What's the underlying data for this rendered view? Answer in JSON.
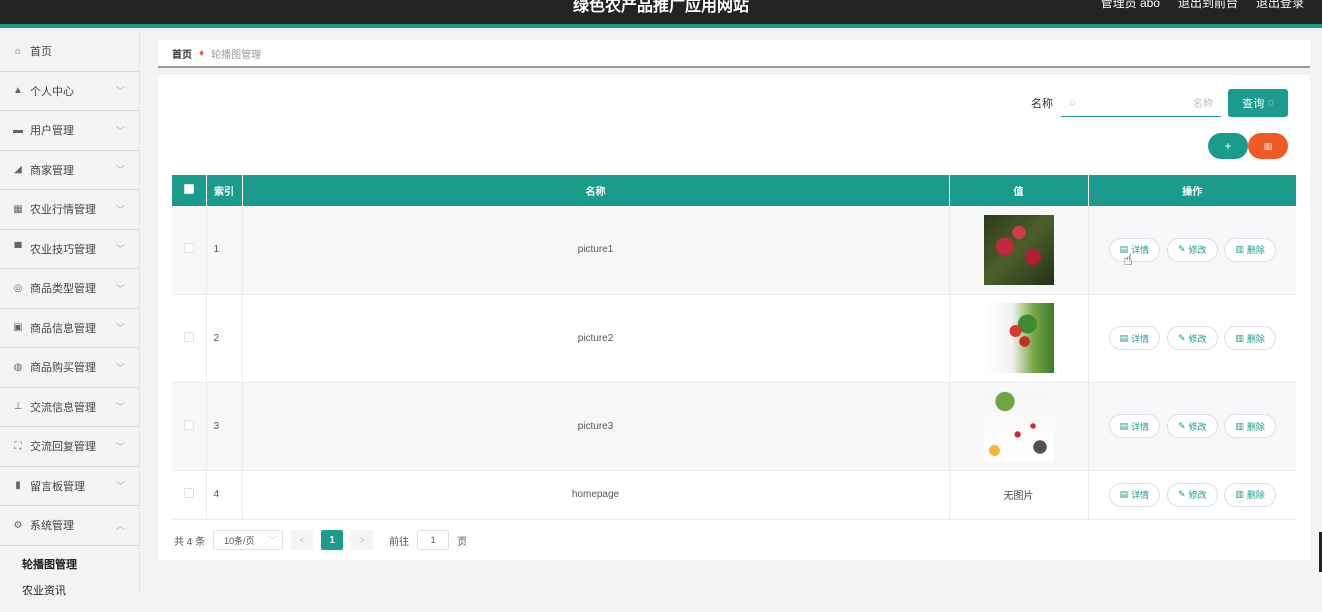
{
  "header": {
    "site_title": "绿色农产品推广应用网站",
    "user_label": "管理员 abo",
    "back_link": "退出到前台",
    "logout_link": "退出登录"
  },
  "sidebar": {
    "items": [
      {
        "icon": "home-icon",
        "glyph": "⌂",
        "label": "首页",
        "chevron": false
      },
      {
        "icon": "person-icon",
        "glyph": "▲",
        "label": "个人中心",
        "chevron": true
      },
      {
        "icon": "card-icon",
        "glyph": "▬",
        "label": "用户管理",
        "chevron": true
      },
      {
        "icon": "paper-plane-icon",
        "glyph": "◢",
        "label": "商家管理",
        "chevron": true
      },
      {
        "icon": "grid-icon",
        "glyph": "▦",
        "label": "农业行情管理",
        "chevron": true
      },
      {
        "icon": "monitor-icon",
        "glyph": "▀",
        "label": "农业技巧管理",
        "chevron": true
      },
      {
        "icon": "compass-icon",
        "glyph": "◎",
        "label": "商品类型管理",
        "chevron": true
      },
      {
        "icon": "picture-icon",
        "glyph": "▣",
        "label": "商品信息管理",
        "chevron": true
      },
      {
        "icon": "gauge-icon",
        "glyph": "◍",
        "label": "商品购买管理",
        "chevron": true
      },
      {
        "icon": "stamp-icon",
        "glyph": "⊥",
        "label": "交流信息管理",
        "chevron": true
      },
      {
        "icon": "frame-icon",
        "glyph": "⛶",
        "label": "交流回复管理",
        "chevron": true
      },
      {
        "icon": "bar-chart-icon",
        "glyph": "▮",
        "label": "留言板管理",
        "chevron": true
      },
      {
        "icon": "gear-icon",
        "glyph": "⚙",
        "label": "系统管理",
        "chevron": true,
        "expanded": true
      }
    ],
    "sub_items": [
      "轮播图管理",
      "农业资讯"
    ]
  },
  "breadcrumb": {
    "home": "首页",
    "current": "轮播图管理"
  },
  "search": {
    "label": "名称",
    "placeholder": "名称",
    "button": "查询"
  },
  "table": {
    "headers": [
      "索引",
      "名称",
      "值",
      "操作"
    ],
    "rows": [
      {
        "index": "1",
        "name": "picture1",
        "value": "image"
      },
      {
        "index": "2",
        "name": "picture2",
        "value": "image"
      },
      {
        "index": "3",
        "name": "picture3",
        "value": "image"
      },
      {
        "index": "4",
        "name": "homepage",
        "value": "无图片"
      }
    ],
    "actions": {
      "detail": "详情",
      "edit": "修改",
      "delete": "删除"
    }
  },
  "pagination": {
    "total": "共 4 条",
    "page_size": "10条/页",
    "current_page": "1",
    "goto_label": "前往",
    "goto_value": "1",
    "page_suffix": "页"
  },
  "colors": {
    "accent": "#1a9b8c",
    "danger": "#f15a24",
    "topbar": "#232323"
  }
}
